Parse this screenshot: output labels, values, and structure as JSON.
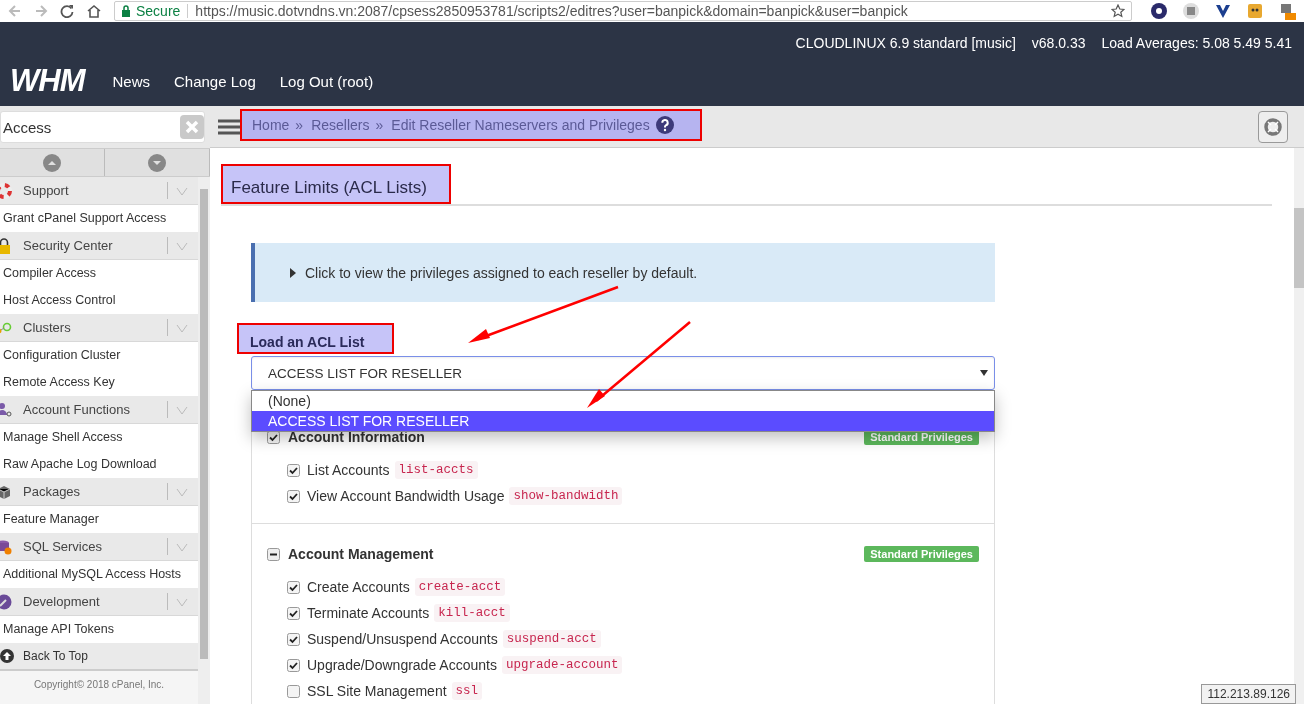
{
  "browser": {
    "secure_label": "Secure",
    "url": "https://music.dotvndns.vn:2087/cpsess2850953781/scripts2/editres?user=banpick&domain=banpick&user=banpick"
  },
  "header": {
    "logo": "WHM",
    "info": [
      "CLOUDLINUX 6.9 standard [music]",
      "v68.0.33",
      "Load Averages: 5.08 5.49 5.41"
    ],
    "nav": [
      "News",
      "Change Log",
      "Log Out (root)"
    ]
  },
  "sidebar": {
    "search": {
      "value": "Access"
    },
    "groups": [
      {
        "title": "Support",
        "kind": "support",
        "expanded": true,
        "items": [
          "Grant cPanel Support Access"
        ]
      },
      {
        "title": "Security Center",
        "kind": "security",
        "expanded": true,
        "items": [
          "Compiler Access",
          "Host Access Control"
        ]
      },
      {
        "title": "Clusters",
        "kind": "clusters",
        "expanded": true,
        "items": [
          "Configuration Cluster",
          "Remote Access Key"
        ]
      },
      {
        "title": "Account Functions",
        "kind": "accounts",
        "expanded": true,
        "items": [
          "Manage Shell Access",
          "Raw Apache Log Download"
        ]
      },
      {
        "title": "Packages",
        "kind": "packages",
        "expanded": true,
        "items": [
          "Feature Manager"
        ]
      },
      {
        "title": "SQL Services",
        "kind": "sql",
        "expanded": true,
        "items": [
          "Additional MySQL Access Hosts"
        ]
      },
      {
        "title": "Development",
        "kind": "development",
        "expanded": true,
        "items": [
          "Manage API Tokens"
        ]
      }
    ],
    "back_to_top": "Back To Top",
    "copyright": "Copyright© 2018 cPanel, Inc."
  },
  "breadcrumb": {
    "highlighted": true,
    "items": [
      {
        "label": "Home",
        "separator": "»"
      },
      {
        "label": "Resellers",
        "separator": "»"
      },
      {
        "label": "Edit Reseller Nameservers and Privileges"
      }
    ]
  },
  "page": {
    "title": {
      "text": "Feature Limits (ACL Lists)",
      "highlighted": true
    },
    "callout": "Click to view the privileges assigned to each reseller by default.",
    "acl_label": {
      "text": "Load an ACL List",
      "highlighted": true
    },
    "acl_select": {
      "value": "ACCESS LIST FOR RESELLER",
      "expanded": true,
      "options": [
        {
          "label": "(None)",
          "selected": false
        },
        {
          "label": "ACCESS LIST FOR RESELLER",
          "selected": true
        }
      ]
    },
    "groups": [
      {
        "title": "Account Information",
        "checked": true,
        "partial": false,
        "badge": "Standard Privileges",
        "items": [
          {
            "label": "List Accounts",
            "code": "list-accts",
            "checked": true
          },
          {
            "label": "View Account Bandwidth Usage",
            "code": "show-bandwidth",
            "checked": true
          }
        ]
      },
      {
        "title": "Account Management",
        "partial": true,
        "badge": "Standard Privileges",
        "items": [
          {
            "label": "Create Accounts",
            "code": "create-acct",
            "checked": true
          },
          {
            "label": "Terminate Accounts",
            "code": "kill-acct",
            "checked": true
          },
          {
            "label": "Suspend/Unsuspend Accounts",
            "code": "suspend-acct",
            "checked": true
          },
          {
            "label": "Upgrade/Downgrade Accounts",
            "code": "upgrade-account",
            "checked": true
          },
          {
            "label": "SSL Site Management",
            "code": "ssl",
            "checked": false
          }
        ]
      }
    ]
  },
  "ip_tooltip": "112.213.89.126"
}
